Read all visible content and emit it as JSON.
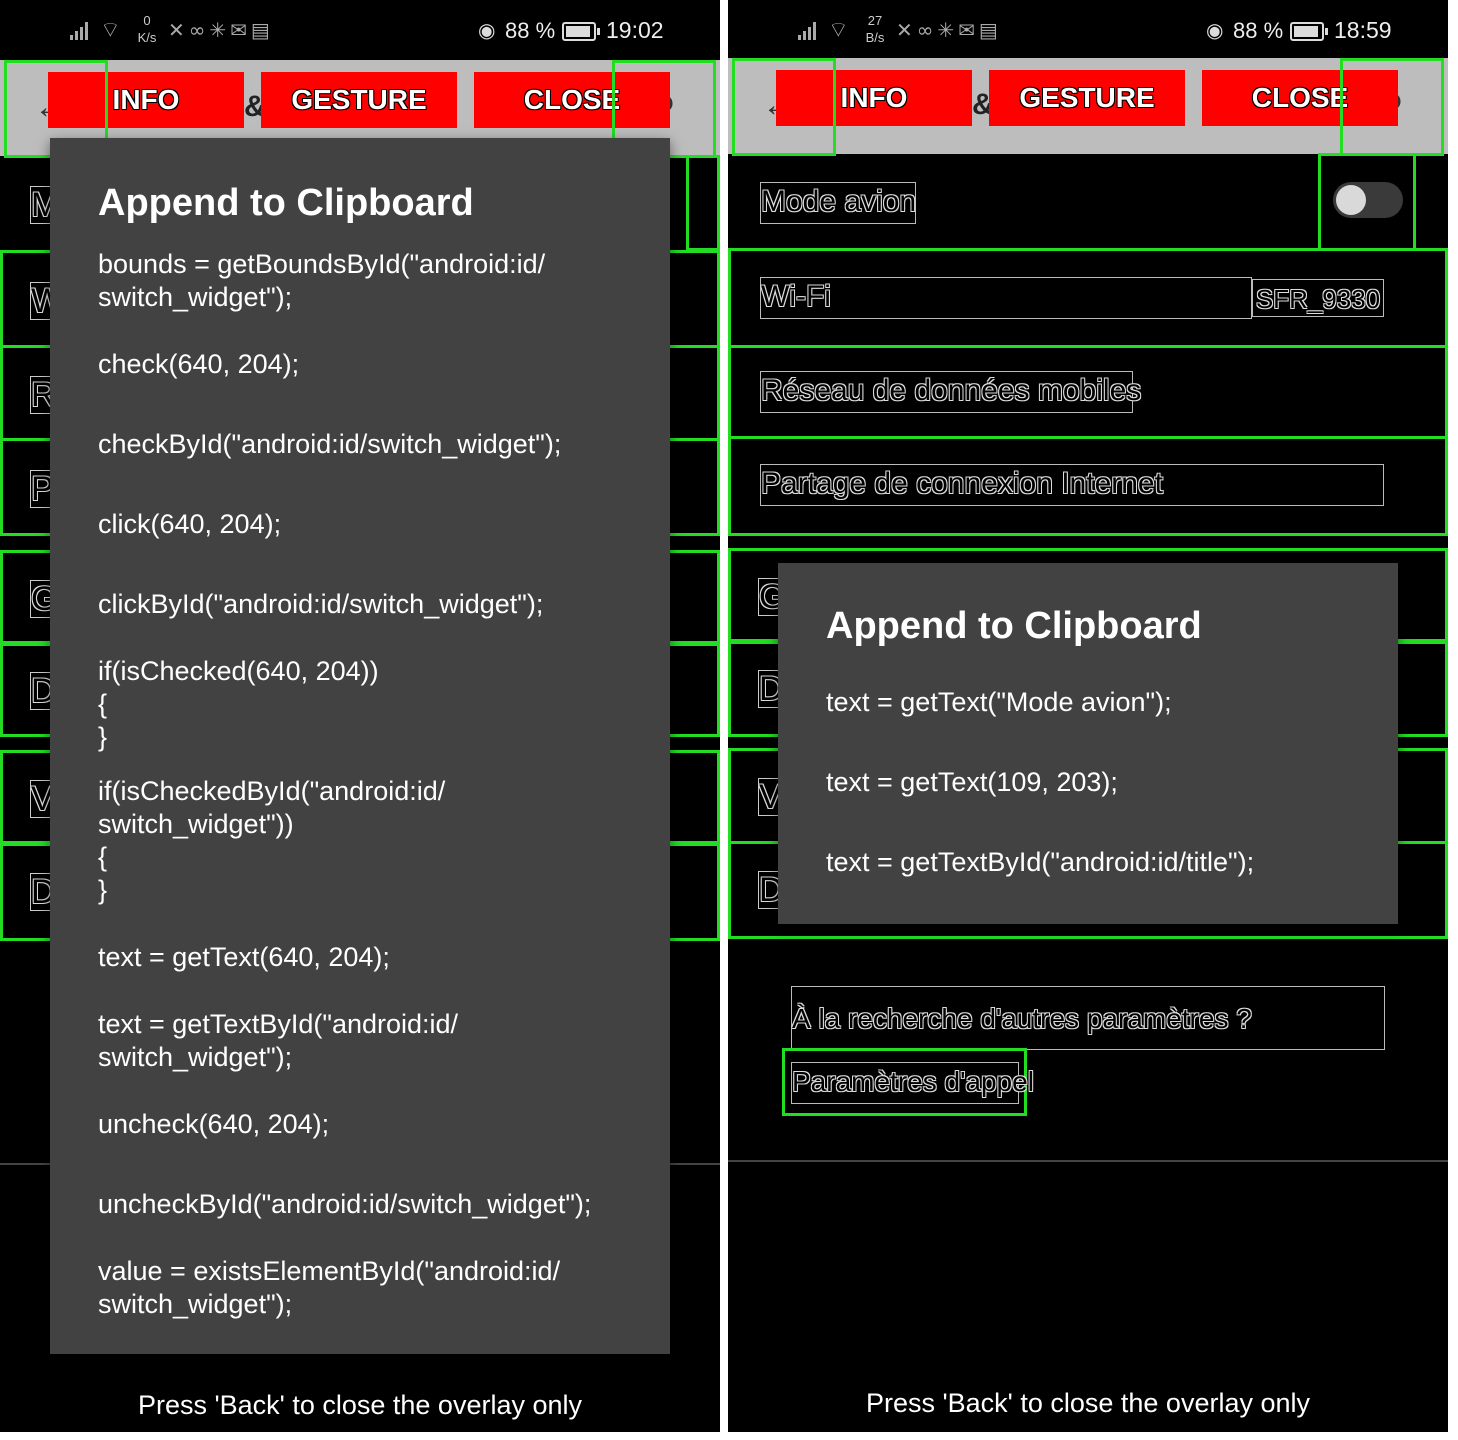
{
  "left": {
    "status": {
      "speed_value": "0",
      "speed_unit": "K/s",
      "battery": "88 %",
      "time": "19:02"
    },
    "toolbar": {
      "info": "INFO",
      "gesture": "GESTURE",
      "close": "CLOSE",
      "amp": "&"
    },
    "row_letters": [
      "M",
      "W",
      "R",
      "P",
      "G",
      "D",
      "V",
      "D"
    ],
    "dialog": {
      "title": "Append to Clipboard",
      "items": [
        "bounds = getBoundsById(\"android:id/\nswitch_widget\");",
        "check(640, 204);",
        "checkById(\"android:id/switch_widget\");",
        "click(640, 204);",
        "clickById(\"android:id/switch_widget\");",
        "if(isChecked(640, 204))\n{\n}",
        "if(isCheckedById(\"android:id/\nswitch_widget\"))\n{\n}",
        "text = getText(640, 204);",
        "text = getTextById(\"android:id/\nswitch_widget\");",
        "uncheck(640, 204);",
        "uncheckById(\"android:id/switch_widget\");",
        "value = existsElementById(\"android:id/\nswitch_widget\");"
      ]
    },
    "footer": "Press 'Back' to close the overlay only"
  },
  "right": {
    "status": {
      "speed_value": "27",
      "speed_unit": "B/s",
      "battery": "88 %",
      "time": "18:59"
    },
    "toolbar": {
      "info": "INFO",
      "gesture": "GESTURE",
      "close": "CLOSE",
      "amp": "&"
    },
    "settings": {
      "airplane_mode": "Mode avion",
      "wifi": "Wi-Fi",
      "wifi_network": "SFR_9330",
      "mobile_data": "Réseau de données mobiles",
      "hotspot": "Partage de connexion Internet",
      "more_settings": "À la recherche d'autres paramètres ?",
      "call_settings": "Paramètres d'appel"
    },
    "row_letters": [
      "G",
      "D",
      "V",
      "D"
    ],
    "dialog": {
      "title": "Append to Clipboard",
      "items": [
        "text = getText(\"Mode avion\");",
        "text = getText(109, 203);",
        "text = getTextById(\"android:id/title\");"
      ]
    },
    "footer": "Press 'Back' to close the overlay only"
  }
}
